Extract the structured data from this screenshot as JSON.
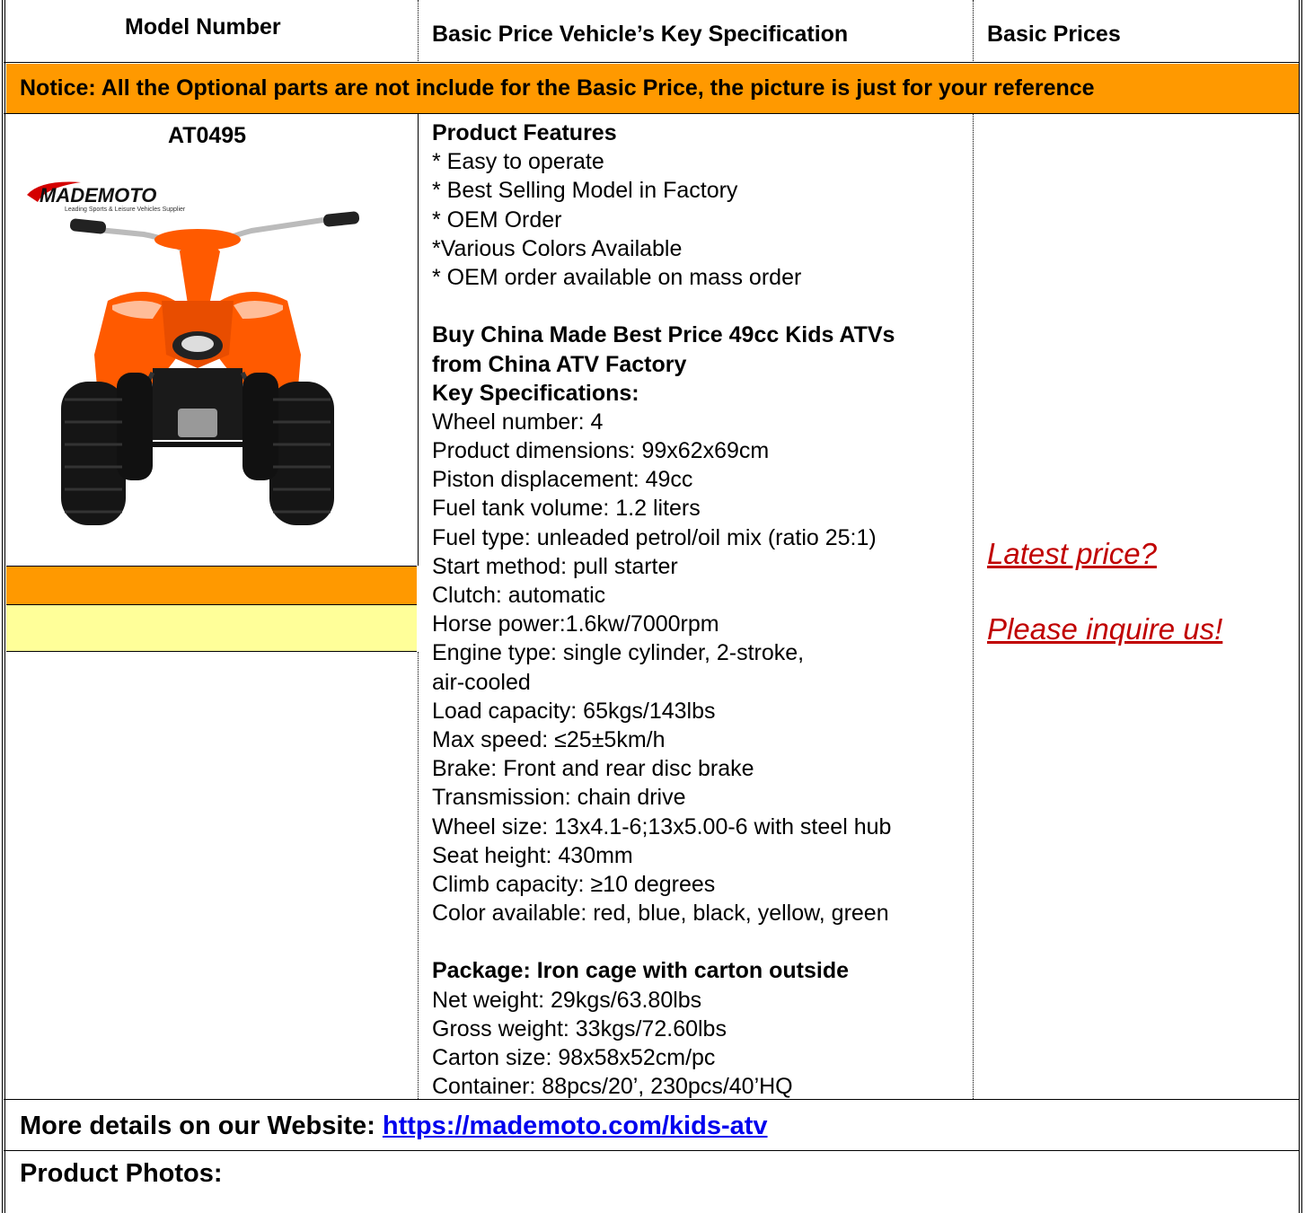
{
  "table_header": {
    "col1": "Model Number",
    "col2": "Basic Price Vehicle’s Key Specification",
    "col3": "Basic Prices"
  },
  "notice": "Notice: All the Optional parts are not include for the Basic Price, the picture is just for your reference",
  "product": {
    "model": "AT0495",
    "logo_text": "MADEMOTO",
    "logo_tagline": "Leading Sports & Leisure Vehicles Supplier",
    "features_title": "Product Features",
    "features": [
      "* Easy to operate",
      "* Best Selling Model in Factory",
      "* OEM Order",
      "*Various Colors Available",
      "* OEM order available on mass order"
    ],
    "headline_1": "Buy China Made Best Price 49cc Kids ATVs",
    "headline_2": "from China ATV Factory",
    "key_specs_title": "Key Specifications:",
    "specs": [
      "Wheel number: 4",
      "Product dimensions: 99x62x69cm",
      "Piston displacement: 49cc",
      "Fuel tank volume: 1.2 liters",
      "Fuel type: unleaded petrol/oil mix (ratio 25:1)",
      "Start method: pull starter",
      "Clutch: automatic",
      "Horse power:1.6kw/7000rpm",
      "Engine type: single cylinder, 2-stroke,",
      "air-cooled",
      "Load capacity: 65kgs/143lbs",
      "Max speed: ≤25±5km/h",
      "Brake: Front and rear disc brake",
      "Transmission: chain drive",
      "Wheel size: 13x4.1-6;13x5.00-6 with steel hub",
      "Seat height: 430mm",
      "Climb capacity: ≥10 degrees",
      "Color available: red, blue, black, yellow, green"
    ],
    "package_title": "Package: Iron cage with carton outside",
    "package": [
      "Net weight: 29kgs/63.80lbs",
      "Gross weight: 33kgs/72.60lbs",
      "Carton size: 98x58x52cm/pc",
      "Container: 88pcs/20’, 230pcs/40’HQ"
    ],
    "price_line_1": "Latest price? ",
    "price_line_2": "Please inquire us!"
  },
  "footer": {
    "details_label": "More details on our Website: ",
    "details_url": "https://mademoto.com/kids-atv",
    "photos_label": "Product Photos:"
  },
  "colors": {
    "notice_band": "#ff9900",
    "yellow_band": "#ffff99",
    "price_link": "#c00000",
    "url_link": "#0000ee",
    "atv_body": "#ff5a00"
  }
}
